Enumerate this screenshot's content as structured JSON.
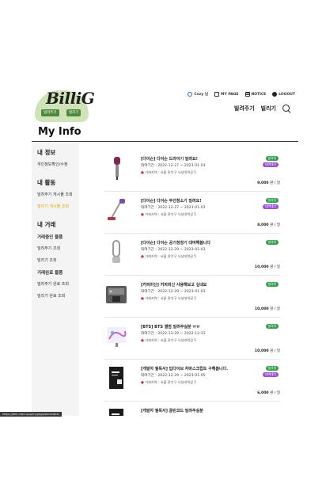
{
  "logo": {
    "text": "BilliG",
    "tag_left": "빌려주기",
    "tag_right": "빌리기"
  },
  "topnav": {
    "user": "Cozy 님",
    "mypage": "MY PAGE",
    "notice": "NOTICE",
    "logout": "LOGOUT"
  },
  "subnav": {
    "lend": "빌려주기",
    "borrow": "빌리기"
  },
  "page_title": "My Info",
  "sidebar": {
    "my_info": "내 정보",
    "edit_info": "개인정보확인/수정",
    "activity": "내 활동",
    "lend_posts": "빌려주기 게시물 조회",
    "borrow_posts": "빌리기 게시물 조회",
    "trades": "내 거래",
    "ongoing": "거래중인 물품",
    "ongoing_lend": "빌려주기 조회",
    "ongoing_borrow": "빌리기 조회",
    "done": "거래완료 물품",
    "done_lend": "빌려주기 완료 조회",
    "done_borrow": "빌리기 완료 조회"
  },
  "items": [
    {
      "title": "[다이슨] 다이슨 드라이기 빌려요!",
      "period": "대여기간 : 2022-12-27 ~ 2023-01-03",
      "location": "거래지역 : 서울 관악구 낙성대역길 5",
      "badge1": "빌려줘",
      "badge2": "대여대기",
      "price": "9,000",
      "unit": "원 / 일",
      "icon": "hair-dryer"
    },
    {
      "title": "[다이슨] 다이슨 무선청소기 빌려요!",
      "period": "대여기간 : 2022-12-27 ~ 2023-01-03",
      "location": "거래지역 : 서울 관악구 낙성대역길 5",
      "badge1": "빌려줘",
      "badge2": "대여대기",
      "price": "8,000",
      "unit": "원 / 일",
      "icon": "vacuum"
    },
    {
      "title": "[다이슨] 다이슨 공기청정기 대여해봅니다",
      "period": "대여기간 : 2022-12-29 ~ 2023-01-03",
      "location": "거래지역 : 서울 관악구 낙성대역길 5",
      "badge1": "빌려줘",
      "badge2": "",
      "price": "10,000",
      "unit": "원 / 일",
      "icon": "air-purifier"
    },
    {
      "title": "[커피머신] 커피머신 사용해보고 싶네요",
      "period": "대여기간 : 2022-12-29 ~ 2023-01-03",
      "location": "거래지역 : 서울 관악구 낙성대역길 5",
      "badge1": "빌려줘",
      "badge2": "",
      "price": "10,000",
      "unit": "원 / 일",
      "icon": "coffee-machine"
    },
    {
      "title": "[BTS] BTS 앨범 빌려주실분 ㅠㅠ",
      "period": "대여기간 : 2022-12-29 ~ 2022-12-31",
      "location": "거래지역 : 서울 관악구 낙성대역길 5",
      "badge1": "빌려줘",
      "badge2": "",
      "price": "10,000",
      "unit": "원 / 일",
      "icon": "album"
    },
    {
      "title": "[개발자 필독서] 딥다이브 자바스크립트 구해봅니다.",
      "period": "대여기간 : 2022-12-29 ~ 2023-01-05",
      "location": "거래지역 : 서울 관악구 낙성대역길 5",
      "badge1": "빌려줘",
      "badge2": "대여대기",
      "price": "6,000",
      "unit": "원 / 일",
      "icon": "book"
    },
    {
      "title": "[개발자 필독서] 클린코드 빌려주실분",
      "period": "",
      "location": "",
      "badge1": "",
      "badge2": "",
      "price": "",
      "unit": "",
      "icon": "book"
    }
  ],
  "status_url": "https://billi-mart.app/mypage/borrowlist"
}
